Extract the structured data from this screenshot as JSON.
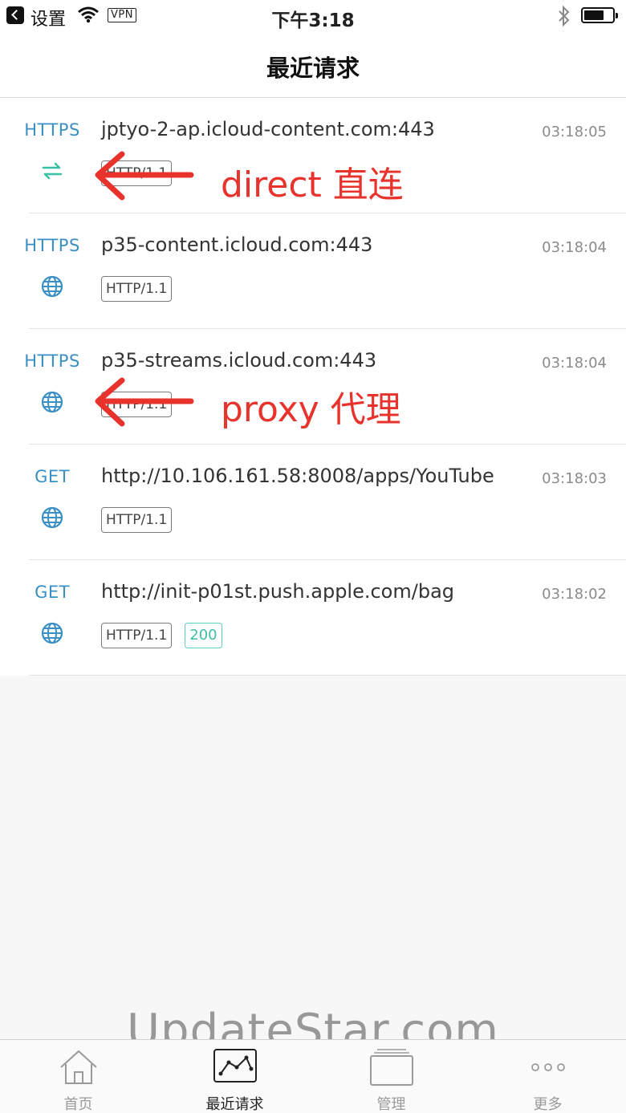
{
  "status_bar": {
    "back_label": "设置",
    "vpn": "VPN",
    "time": "下午3:18"
  },
  "nav": {
    "title": "最近请求"
  },
  "requests": [
    {
      "method": "HTTPS",
      "url": "jptyo-2-ap.icloud-content.com:443",
      "time": "03:18:05",
      "protocol": "HTTP/1.1",
      "mode_icon": "direct-arrows-icon",
      "status": ""
    },
    {
      "method": "HTTPS",
      "url": "p35-content.icloud.com:443",
      "time": "03:18:04",
      "protocol": "HTTP/1.1",
      "mode_icon": "globe-icon",
      "status": ""
    },
    {
      "method": "HTTPS",
      "url": "p35-streams.icloud.com:443",
      "time": "03:18:04",
      "protocol": "HTTP/1.1",
      "mode_icon": "globe-icon",
      "status": ""
    },
    {
      "method": "GET",
      "url": "http://10.106.161.58:8008/apps/YouTube",
      "time": "03:18:03",
      "protocol": "HTTP/1.1",
      "mode_icon": "globe-icon",
      "status": ""
    },
    {
      "method": "GET",
      "url": "http://init-p01st.push.apple.com/bag",
      "time": "03:18:02",
      "protocol": "HTTP/1.1",
      "mode_icon": "globe-icon",
      "status": "200"
    }
  ],
  "annotations": {
    "direct": "direct 直连",
    "proxy": "proxy 代理"
  },
  "watermark": "UpdateStar.com",
  "tabs": [
    {
      "label": "首页",
      "icon": "home-icon"
    },
    {
      "label": "最近请求",
      "icon": "chart-icon",
      "active": true
    },
    {
      "label": "管理",
      "icon": "stack-icon"
    },
    {
      "label": "更多",
      "icon": "more-icon"
    }
  ],
  "colors": {
    "method": "#3a8fc4",
    "direct_icon": "#3dbfa6",
    "globe_icon": "#3a8fc4",
    "annotation": "#e8332c",
    "status_200": "#3dbfa6"
  }
}
